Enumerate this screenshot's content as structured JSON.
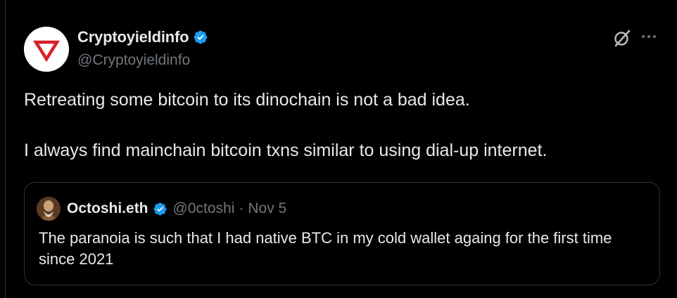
{
  "author": {
    "name": "Cryptoyieldinfo",
    "handle": "@Cryptoyieldinfo",
    "verified_color": "#1d9bf0",
    "avatar_icon": "red-triangle-logo"
  },
  "actions": {
    "grok_icon": "grok-icon",
    "more_icon": "more-options-icon"
  },
  "tweet": {
    "text": "Retreating some bitcoin to its dinochain is not a bad idea.\n\nI always find mainchain bitcoin txns similar to using dial-up internet."
  },
  "quote": {
    "name": "Octoshi.eth",
    "handle": "@0ctoshi",
    "separator": "·",
    "date": "Nov 5",
    "text": "The paranoia is such that I had native BTC in my cold wallet againg for the first time since 2021"
  },
  "colors": {
    "background": "#000000",
    "text": "#e7e9ea",
    "muted": "#71767b",
    "border": "#2f3336",
    "accent": "#1d9bf0",
    "logo_red": "#d81f26"
  }
}
